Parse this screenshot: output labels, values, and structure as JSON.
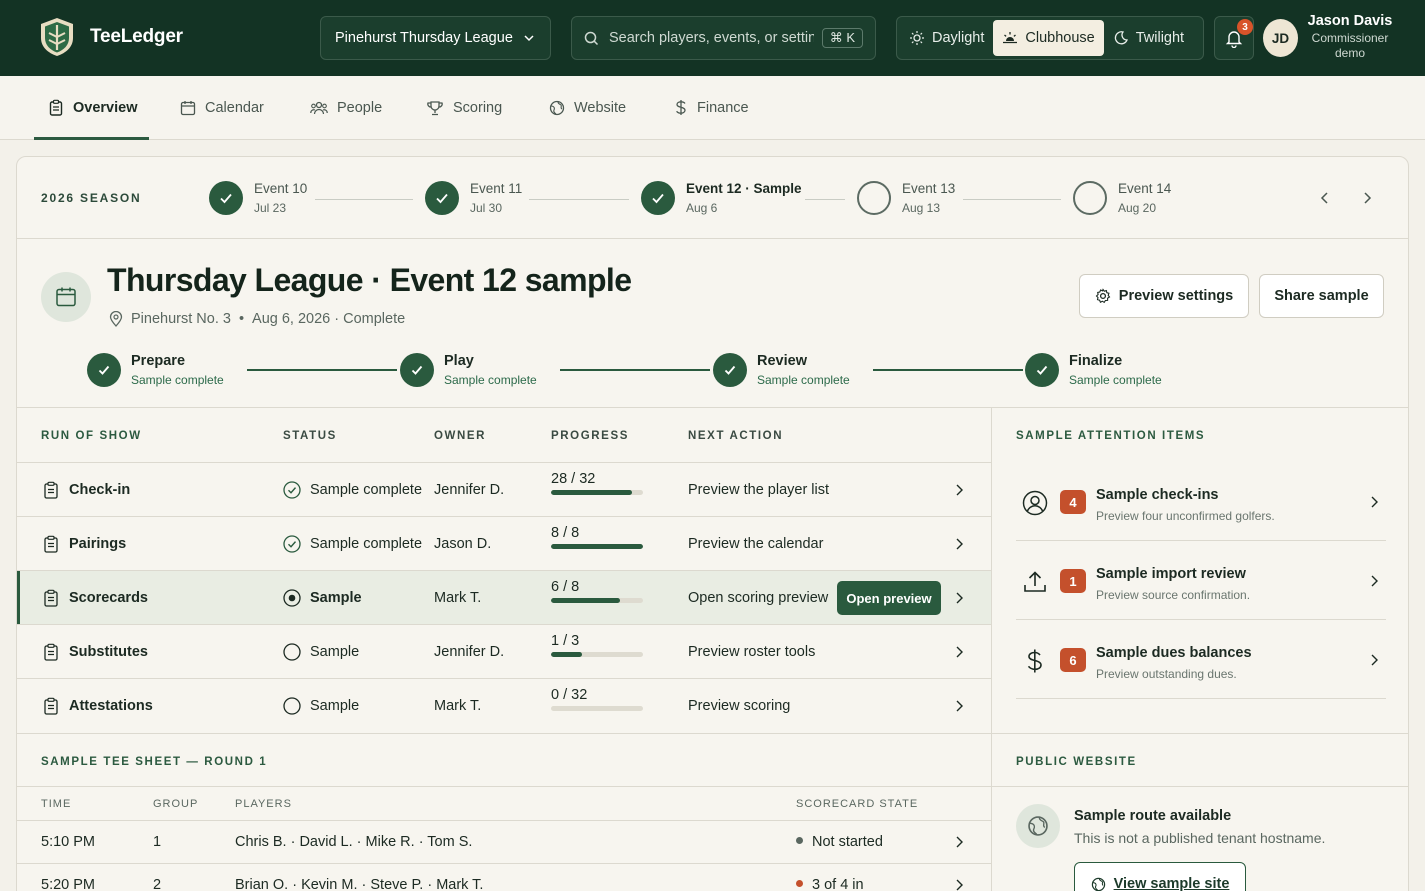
{
  "app": {
    "name": "TeeLedger"
  },
  "league_selector": {
    "value": "Pinehurst Thursday League"
  },
  "search": {
    "placeholder": "Search players, events, or settings",
    "shortcut": "⌘ K"
  },
  "theme": {
    "options": [
      "Daylight",
      "Clubhouse",
      "Twilight"
    ],
    "active": "Clubhouse"
  },
  "notifications": {
    "count": "3"
  },
  "user": {
    "initials": "JD",
    "name": "Jason Davis",
    "role": "Commissioner demo"
  },
  "nav": {
    "items": [
      {
        "label": "Overview",
        "icon": "clipboard-icon",
        "active": true
      },
      {
        "label": "Calendar",
        "icon": "calendar-icon"
      },
      {
        "label": "People",
        "icon": "people-icon"
      },
      {
        "label": "Scoring",
        "icon": "trophy-icon"
      },
      {
        "label": "Website",
        "icon": "globe-icon"
      },
      {
        "label": "Finance",
        "icon": "dollar-icon"
      }
    ]
  },
  "season": {
    "label": "2026 SEASON",
    "events": [
      {
        "name": "Event 10",
        "date": "Jul 23",
        "done": true
      },
      {
        "name": "Event 11",
        "date": "Jul 30",
        "done": true
      },
      {
        "name": "Event 12 · Sample",
        "date": "Aug 6",
        "done": true,
        "current": true
      },
      {
        "name": "Event 13",
        "date": "Aug 13",
        "done": false
      },
      {
        "name": "Event 14",
        "date": "Aug 20",
        "done": false
      }
    ]
  },
  "event": {
    "title": "Thursday League · Event 12 sample",
    "course": "Pinehurst No. 3",
    "date_status": "Aug 6, 2026 · Complete",
    "preview_settings_label": "Preview settings",
    "share_label": "Share sample"
  },
  "phases": [
    {
      "name": "Prepare",
      "status": "Sample complete"
    },
    {
      "name": "Play",
      "status": "Sample complete"
    },
    {
      "name": "Review",
      "status": "Sample complete"
    },
    {
      "name": "Finalize",
      "status": "Sample complete"
    }
  ],
  "run_of_show": {
    "headers": {
      "title": "RUN OF SHOW",
      "status": "STATUS",
      "owner": "OWNER",
      "progress": "PROGRESS",
      "next": "NEXT ACTION"
    },
    "rows": [
      {
        "name": "Check-in",
        "status": "Sample complete",
        "state": "complete",
        "owner": "Jennifer D.",
        "progress": "28 / 32",
        "fraction": 0.875,
        "next": "Preview the player list"
      },
      {
        "name": "Pairings",
        "status": "Sample complete",
        "state": "complete",
        "owner": "Jason D.",
        "progress": "8 / 8",
        "fraction": 1.0,
        "next": "Preview the calendar"
      },
      {
        "name": "Scorecards",
        "status": "Sample",
        "state": "active",
        "owner": "Mark T.",
        "progress": "6 / 8",
        "fraction": 0.75,
        "next": "Open scoring preview",
        "button": "Open preview"
      },
      {
        "name": "Substitutes",
        "status": "Sample",
        "state": "pending",
        "owner": "Jennifer D.",
        "progress": "1 / 3",
        "fraction": 0.333,
        "next": "Preview roster tools"
      },
      {
        "name": "Attestations",
        "status": "Sample",
        "state": "pending",
        "owner": "Mark T.",
        "progress": "0 / 32",
        "fraction": 0.0,
        "next": "Preview scoring"
      }
    ]
  },
  "attention": {
    "title": "SAMPLE ATTENTION ITEMS",
    "items": [
      {
        "icon": "user-circle-icon",
        "count": "4",
        "title": "Sample check-ins",
        "desc": "Preview four unconfirmed golfers."
      },
      {
        "icon": "upload-icon",
        "count": "1",
        "title": "Sample import review",
        "desc": "Preview source confirmation."
      },
      {
        "icon": "dollar-icon",
        "count": "6",
        "title": "Sample dues balances",
        "desc": "Preview outstanding dues."
      }
    ]
  },
  "tee_sheet": {
    "title": "SAMPLE TEE SHEET — ROUND 1",
    "headers": {
      "time": "TIME",
      "group": "GROUP",
      "players": "PLAYERS",
      "state": "SCORECARD STATE"
    },
    "rows": [
      {
        "time": "5:10 PM",
        "group": "1",
        "players": "Chris B. · David L. · Mike R. · Tom S.",
        "state": "Not started",
        "dot_color": "#5a6760"
      },
      {
        "time": "5:20 PM",
        "group": "2",
        "players": "Brian O. · Kevin M. · Steve P. · Mark T.",
        "state": "3 of 4 in",
        "dot_color": "#c4502c"
      }
    ]
  },
  "public_site": {
    "title": "PUBLIC WEBSITE",
    "heading": "Sample route available",
    "desc": "This is not a published tenant hostname.",
    "button": "View sample site"
  }
}
